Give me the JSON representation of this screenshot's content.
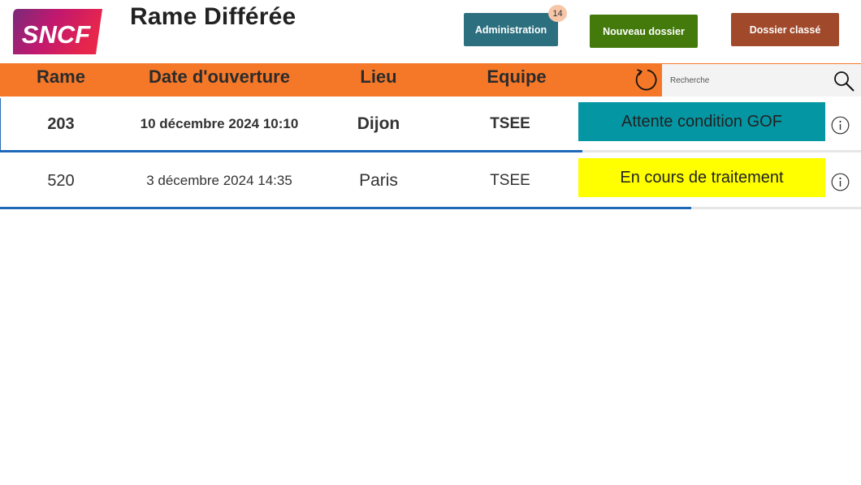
{
  "app": {
    "logo_text": "SNCF",
    "title": "Rame Différée"
  },
  "toolbar": {
    "admin_label": "Administration",
    "admin_badge": "14",
    "new_label": "Nouveau dossier",
    "archived_label": "Dossier classé"
  },
  "colors": {
    "header_bar": "#f57829",
    "admin_button": "#2c6f7f",
    "new_button": "#437a0b",
    "archived_button": "#a0492b",
    "badge": "#f7c6a8",
    "progress": "#1f68b8",
    "status_attente": "#0596a3",
    "status_en_cours": "#ffff00"
  },
  "table": {
    "columns": [
      "Rame",
      "Date d'ouverture",
      "Lieu",
      "Equipe"
    ],
    "search_placeholder": "Recherche",
    "icons": {
      "refresh": "refresh-icon",
      "search": "search-icon",
      "info": "info-icon"
    },
    "rows": [
      {
        "rame": "203",
        "date": "10 décembre 2024 10:10",
        "lieu": "Dijon",
        "equipe": "TSEE",
        "status": "Attente condition GOF",
        "status_color": "#0596a3",
        "progress": 0.676
      },
      {
        "rame": "520",
        "date": "3 décembre 2024 14:35",
        "lieu": "Paris",
        "equipe": "TSEE",
        "status": "En cours de traitement",
        "status_color": "#ffff00",
        "progress": 0.803
      }
    ]
  }
}
